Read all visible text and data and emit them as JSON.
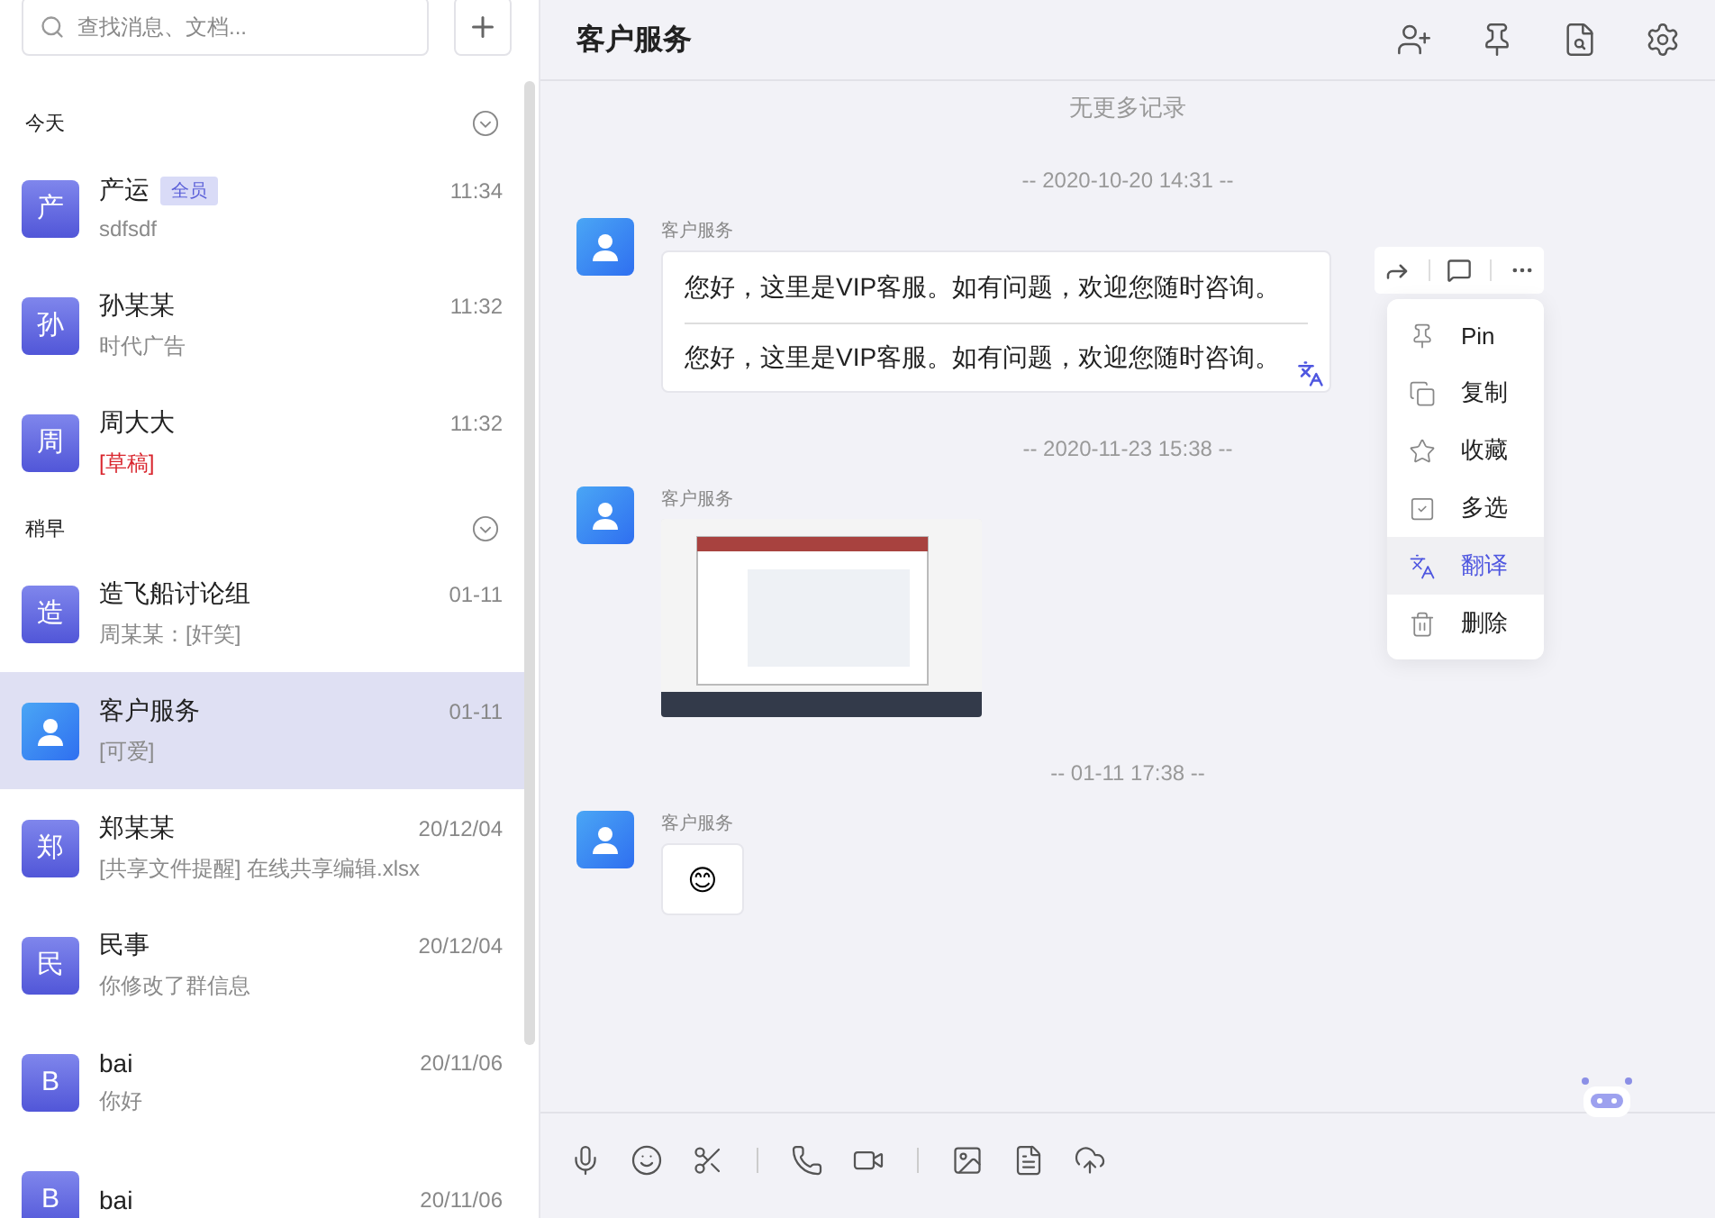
{
  "search": {
    "placeholder": "查找消息、文档..."
  },
  "sections": [
    {
      "title": "今天",
      "expanded": true,
      "conversations": [
        {
          "kind": "letter",
          "avatar": "产",
          "name": "产运",
          "badge": "全员",
          "time": "11:34",
          "preview": "sdfsdf",
          "draft": false,
          "selected": false
        },
        {
          "kind": "letter",
          "avatar": "孙",
          "name": "孙某某",
          "time": "11:32",
          "preview": "时代广告",
          "draft": false,
          "selected": false
        },
        {
          "kind": "letter",
          "avatar": "周",
          "name": "周大大",
          "time": "11:32",
          "preview": "[草稿]",
          "draft": true,
          "selected": false
        }
      ]
    },
    {
      "title": "稍早",
      "expanded": true,
      "conversations": [
        {
          "kind": "letter",
          "avatar": "造",
          "name": "造飞船讨论组",
          "time": "01-11",
          "preview": "周某某：[奸笑]",
          "draft": false,
          "selected": false
        },
        {
          "kind": "service",
          "name": "客户服务",
          "time": "01-11",
          "preview": "[可爱]",
          "draft": false,
          "selected": true
        },
        {
          "kind": "letter",
          "avatar": "郑",
          "name": "郑某某",
          "time": "20/12/04",
          "preview": "[共享文件提醒] 在线共享编辑.xlsx",
          "draft": false,
          "selected": false
        },
        {
          "kind": "letter",
          "avatar": "民",
          "name": "民事",
          "time": "20/12/04",
          "preview": "你修改了群信息",
          "draft": false,
          "selected": false
        },
        {
          "kind": "letter",
          "avatar": "B",
          "name": "bai",
          "time": "20/11/06",
          "preview": "你好",
          "draft": false,
          "selected": false
        },
        {
          "kind": "letter",
          "avatar": "B",
          "name": "bai",
          "time": "20/11/06",
          "selected": false
        }
      ]
    }
  ],
  "chat": {
    "title": "客户服务",
    "messages": [
      {
        "kind": "notice",
        "text": "无更多记录"
      },
      {
        "kind": "time",
        "text": "-- 2020-10-20 14:31 --"
      },
      {
        "kind": "text",
        "sender": "客户服务",
        "text": "您好，这里是VIP客服。如有问题，欢迎您随时咨询。",
        "translation": "您好，这里是VIP客服。如有问题，欢迎您随时咨询。"
      },
      {
        "kind": "time",
        "text": "-- 2020-11-23 15:38 --"
      },
      {
        "kind": "image",
        "sender": "客户服务"
      },
      {
        "kind": "time",
        "text": "-- 01-11 17:38 --"
      },
      {
        "kind": "emoji",
        "sender": "客户服务",
        "text": "😊"
      }
    ],
    "context_menu": [
      {
        "label": "Pin",
        "selected": false
      },
      {
        "label": "复制",
        "selected": false
      },
      {
        "label": "收藏",
        "selected": false
      },
      {
        "label": "多选",
        "selected": false
      },
      {
        "label": "翻译",
        "selected": true
      },
      {
        "label": "删除",
        "selected": false
      }
    ]
  }
}
